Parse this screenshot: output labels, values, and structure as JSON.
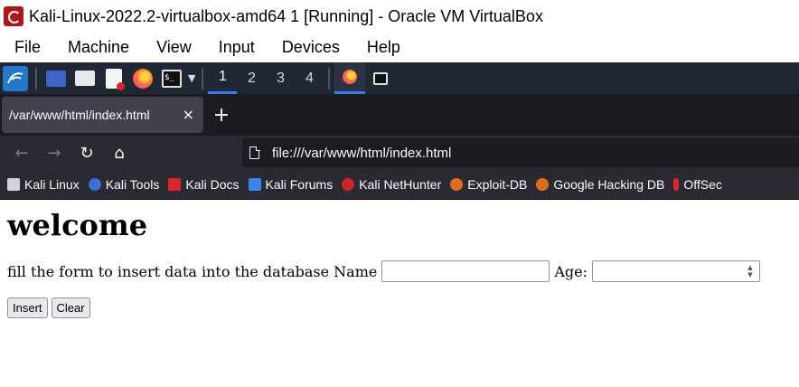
{
  "window": {
    "title": "Kali-Linux-2022.2-virtualbox-amd64 1 [Running] - Oracle VM VirtualBox"
  },
  "vbox_menu": [
    "File",
    "Machine",
    "View",
    "Input",
    "Devices",
    "Help"
  ],
  "panel": {
    "launchers": [
      "kali-menu-icon",
      "desktop-icon",
      "file-manager-icon",
      "text-editor-icon",
      "firefox-icon",
      "terminal-icon"
    ],
    "workspaces": [
      "1",
      "2",
      "3",
      "4"
    ],
    "active_workspace": "1",
    "tasks": [
      "firefox-task-icon",
      "terminal-task-icon"
    ]
  },
  "browser": {
    "tab": {
      "title": "/var/www/html/index.html",
      "close": "×"
    },
    "new_tab": "+",
    "nav": {
      "back": "←",
      "forward": "→",
      "reload": "↻",
      "home": "⌂"
    },
    "url": "file:///var/www/html/index.html",
    "bookmarks": [
      {
        "label": "Kali Linux",
        "color": "#cfd3da"
      },
      {
        "label": "Kali Tools",
        "color": "#3a6ed8"
      },
      {
        "label": "Kali Docs",
        "color": "#d8262c"
      },
      {
        "label": "Kali Forums",
        "color": "#3a86e8"
      },
      {
        "label": "Kali NetHunter",
        "color": "#c8262c"
      },
      {
        "label": "Exploit-DB",
        "color": "#e06a1f"
      },
      {
        "label": "Google Hacking DB",
        "color": "#e06a1f"
      },
      {
        "label": "OffSec",
        "color": "#d8262c"
      }
    ]
  },
  "page": {
    "heading": "welcome",
    "form_text": "fill the form to insert data into the database Name",
    "name_value": "",
    "age_label": "Age:",
    "age_value": "",
    "insert_label": "Insert",
    "clear_label": "Clear"
  }
}
